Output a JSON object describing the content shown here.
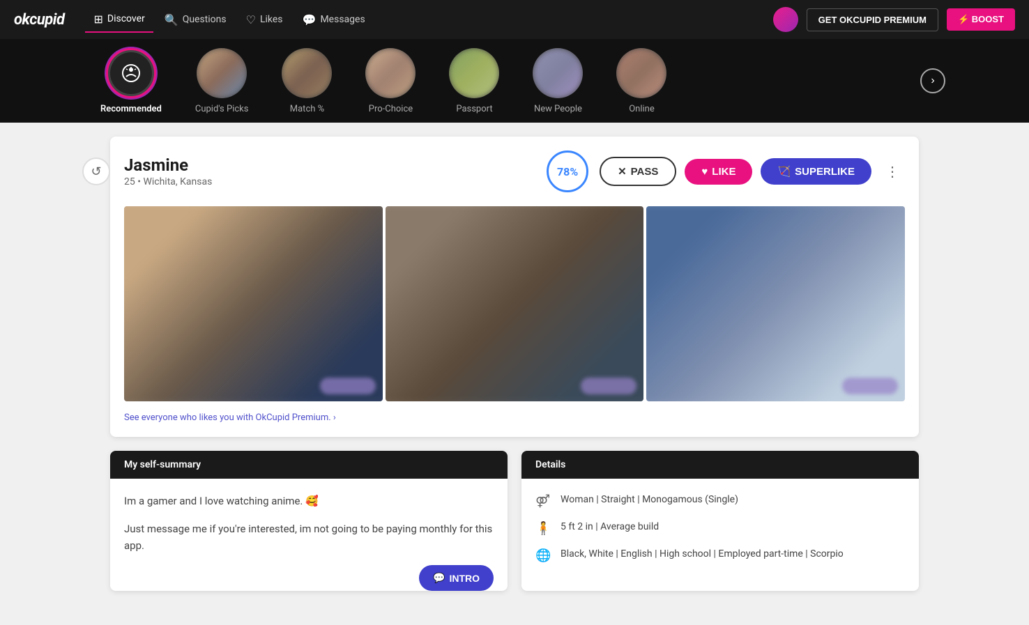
{
  "app": {
    "logo": "okcupid"
  },
  "header": {
    "nav": [
      {
        "id": "discover",
        "label": "Discover",
        "icon": "⊞",
        "active": true
      },
      {
        "id": "questions",
        "label": "Questions",
        "icon": "❓"
      },
      {
        "id": "likes",
        "label": "Likes",
        "icon": "♡"
      },
      {
        "id": "messages",
        "label": "Messages",
        "icon": "💬"
      }
    ],
    "premium_btn": "GET OKCUPID PREMIUM",
    "boost_btn": "⚡ BOOST"
  },
  "categories": [
    {
      "id": "recommended",
      "label": "Recommended",
      "active": true,
      "icon": "✨"
    },
    {
      "id": "cupids-picks",
      "label": "Cupid's Picks",
      "active": false
    },
    {
      "id": "match",
      "label": "Match %",
      "active": false
    },
    {
      "id": "pro-choice",
      "label": "Pro-Choice",
      "active": false
    },
    {
      "id": "passport",
      "label": "Passport",
      "active": false
    },
    {
      "id": "new-people",
      "label": "New People",
      "active": false
    },
    {
      "id": "online",
      "label": "Online",
      "active": false
    }
  ],
  "profile": {
    "name": "Jasmine",
    "age": "25",
    "location": "Wichita, Kansas",
    "match_percent": "78%",
    "pass_label": "PASS",
    "like_label": "LIKE",
    "superlike_label": "SUPERLIKE",
    "premium_cta": "See everyone who likes you with OkCupid Premium. ›",
    "self_summary_header": "My self-summary",
    "self_summary_text1": "Im a gamer and I love watching anime. 🥰",
    "self_summary_text2": "Just message me if you're interested, im not going to be paying monthly for this app.",
    "intro_btn": "INTRO",
    "details_header": "Details",
    "detail1": "Woman | Straight | Monogamous (Single)",
    "detail2": "5 ft 2 in | Average build",
    "detail3": "Black, White | English | High school | Employed part-time | Scorpio"
  }
}
